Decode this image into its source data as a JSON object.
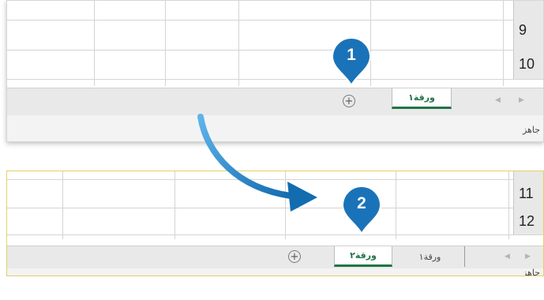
{
  "panel_top": {
    "rows": [
      {
        "header": "9"
      },
      {
        "header": "10"
      }
    ],
    "sheet_tabs": [
      {
        "label": "ورقة١",
        "active": true
      }
    ],
    "new_sheet_button": "+",
    "status": "جاهز"
  },
  "panel_bottom": {
    "rows": [
      {
        "header": "11"
      },
      {
        "header": "12"
      }
    ],
    "sheet_tabs": [
      {
        "label": "ورقة٢",
        "active": true
      },
      {
        "label": "ورقة١",
        "active": false
      }
    ],
    "new_sheet_button": "+",
    "status": "جاهز"
  },
  "callouts": [
    {
      "number": "1"
    },
    {
      "number": "2"
    }
  ],
  "colors": {
    "callout_blue": "#1a73b8",
    "active_tab_green": "#217346",
    "arrow_blue": "#1c7dc4"
  }
}
